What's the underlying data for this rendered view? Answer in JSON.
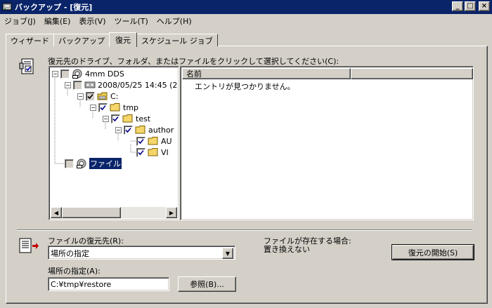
{
  "window": {
    "title": "バックアップ - [復元]",
    "controls": [
      "_",
      "□",
      "×"
    ]
  },
  "menu": [
    "ジョブ(J)",
    "編集(E)",
    "表示(V)",
    "ツール(T)",
    "ヘルプ(H)"
  ],
  "tabs": [
    "ウィザード",
    "バックアップ",
    "復元",
    "スケジュール ジョブ"
  ],
  "active_tab": "復元",
  "restore": {
    "tree_prompt": "復元先のドライブ、フォルダ、またはファイルをクリックして選択してください(C):",
    "tree": [
      {
        "label": "4mm DDS",
        "checked": "partial",
        "icon": "tape-drive-icon",
        "expanded": true
      },
      {
        "label": "2008/05/25 14:45 (2",
        "checked": "partial",
        "icon": "media-set-icon",
        "expanded": true
      },
      {
        "label": "C:",
        "checked": "partial",
        "icon": "drive-icon",
        "expanded": true
      },
      {
        "label": "tmp",
        "checked": "checked",
        "icon": "folder-icon",
        "expanded": true
      },
      {
        "label": "test",
        "checked": "checked",
        "icon": "folder-icon",
        "expanded": true
      },
      {
        "label": "author",
        "checked": "checked",
        "icon": "folder-icon",
        "expanded": true
      },
      {
        "label": "AU",
        "checked": "checked",
        "icon": "folder-icon",
        "expanded": false
      },
      {
        "label": "VI",
        "checked": "checked",
        "icon": "folder-icon",
        "expanded": false
      },
      {
        "label": "ファイル",
        "checked": "unchecked",
        "icon": "file-media-icon",
        "expanded": false,
        "selected": true
      }
    ],
    "list": {
      "columns": [
        "名前",
        ""
      ],
      "empty_message": "エントリが見つかりません。"
    },
    "destination_label": "ファイルの復元先(R):",
    "destination_value": "場所の指定",
    "location_label": "場所の指定(A):",
    "location_value": "C:¥tmp¥restore",
    "browse_button": "参照(B)...",
    "exists_label": "ファイルが存在する場合:",
    "exists_value": "置き換えない",
    "start_button": "復元の開始(S)"
  },
  "colors": {
    "titlebar": "#0a246a",
    "face": "#d4d0c8",
    "highlight": "#0a246a"
  }
}
